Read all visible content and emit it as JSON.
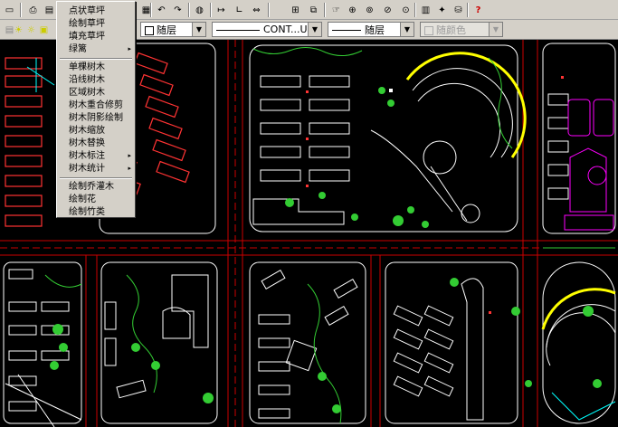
{
  "toolbar": {
    "layer_value": "随层",
    "linetype_value": "CONT...UOUS",
    "lineweight_value": "随层",
    "color_value": "随颜色",
    "help_glyph": "?"
  },
  "menu": {
    "items": [
      {
        "label": "点状草坪",
        "submenu": false
      },
      {
        "label": "绘制草坪",
        "submenu": false
      },
      {
        "label": "填充草坪",
        "submenu": false
      },
      {
        "label": "绿篱",
        "submenu": true
      },
      {
        "label": "单棵树木",
        "submenu": false
      },
      {
        "label": "沿线树木",
        "submenu": false
      },
      {
        "label": "区域树木",
        "submenu": false
      },
      {
        "label": "树木重合修剪",
        "submenu": false
      },
      {
        "label": "树木阴影绘制",
        "submenu": false
      },
      {
        "label": "树木缩放",
        "submenu": false
      },
      {
        "label": "树木替换",
        "submenu": false
      },
      {
        "label": "树木标注",
        "submenu": true
      },
      {
        "label": "树木统计",
        "submenu": true
      },
      {
        "label": "绘制乔灌木",
        "submenu": false
      },
      {
        "label": "绘制花",
        "submenu": false
      },
      {
        "label": "绘制竹类",
        "submenu": false
      }
    ],
    "submenu_arrow": "▸"
  },
  "drawing": {
    "background": "#000000",
    "road_color": "#cc0000",
    "building_color": "#ffffff",
    "tree_color": "#33cc33",
    "highlight_color": "#ff00ff",
    "accent_color": "#ffff00"
  }
}
